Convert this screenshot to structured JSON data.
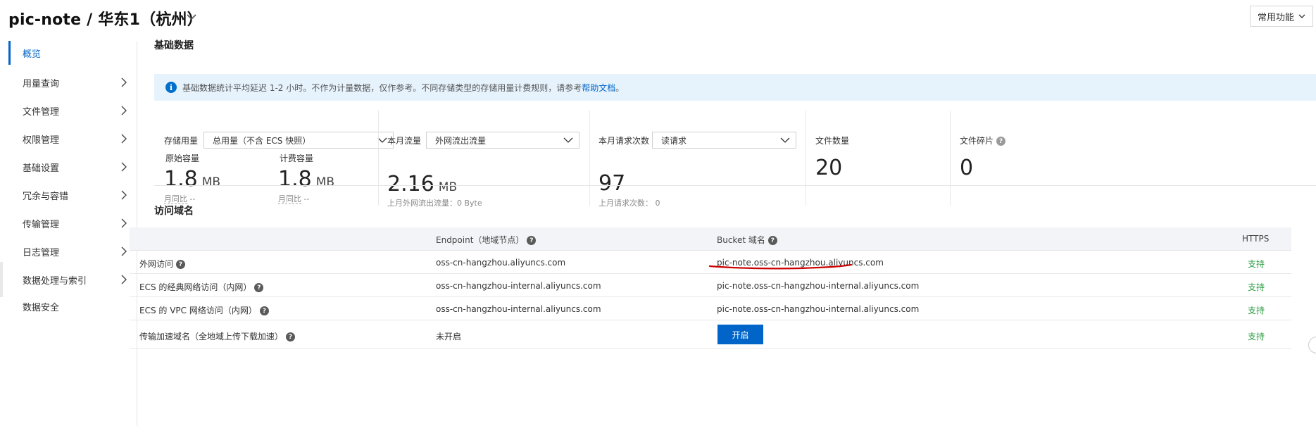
{
  "header": {
    "title": "pic-note / 华东1（杭州）",
    "common_functions": "常用功能"
  },
  "sidebar": {
    "items": [
      {
        "label": "概览"
      },
      {
        "label": "用量查询"
      },
      {
        "label": "文件管理"
      },
      {
        "label": "权限管理"
      },
      {
        "label": "基础设置"
      },
      {
        "label": "冗余与容错"
      },
      {
        "label": "传输管理"
      },
      {
        "label": "日志管理"
      },
      {
        "label": "数据处理与索引"
      },
      {
        "label": "数据安全"
      }
    ]
  },
  "basic_data": {
    "title": "基础数据",
    "info_text": "基础数据统计平均延迟 1-2 小时。不作为计量数据，仅作参考。不同存储类型的存储用量计费规则，请参考",
    "info_link": "帮助文档",
    "info_tail": "。",
    "storage": {
      "label": "存储用量",
      "select": "总用量（不含 ECS 快照）",
      "original_label": "原始容量",
      "original_value": "1.8",
      "original_unit": "MB",
      "original_note_key": "月同比",
      "original_note_val": "--",
      "billing_label": "计费容量",
      "billing_value": "1.8",
      "billing_unit": "MB",
      "billing_note_key": "月同比",
      "billing_note_val": "--"
    },
    "traffic": {
      "label": "本月流量",
      "select": "外网流出流量",
      "value": "2.16",
      "unit": "MB",
      "note": "上月外网流出流量：0 Byte"
    },
    "requests": {
      "label": "本月请求次数",
      "select": "读请求",
      "value": "97",
      "note_key": "上月请求次数：",
      "note_val": "0"
    },
    "files": {
      "label": "文件数量",
      "value": "20"
    },
    "fragments": {
      "label": "文件碎片",
      "value": "0"
    }
  },
  "access_domains": {
    "title": "访问域名",
    "headers": {
      "endpoint": "Endpoint（地域节点）",
      "bucket": "Bucket 域名",
      "https": "HTTPS"
    },
    "rows": [
      {
        "name": "外网访问",
        "endpoint": "oss-cn-hangzhou.aliyuncs.com",
        "bucket": "pic-note.oss-cn-hangzhou.aliyuncs.com",
        "https": "支持"
      },
      {
        "name": "ECS 的经典网络访问（内网）",
        "endpoint": "oss-cn-hangzhou-internal.aliyuncs.com",
        "bucket": "pic-note.oss-cn-hangzhou-internal.aliyuncs.com",
        "https": "支持"
      },
      {
        "name": "ECS 的 VPC 网络访问（内网）",
        "endpoint": "oss-cn-hangzhou-internal.aliyuncs.com",
        "bucket": "pic-note.oss-cn-hangzhou-internal.aliyuncs.com",
        "https": "支持"
      },
      {
        "name": "传输加速域名（全地域上传下载加速）",
        "endpoint": "未开启",
        "bucket_button": "开启",
        "https": "支持"
      }
    ]
  },
  "colors": {
    "accent": "#0064c8",
    "info_bg": "#e6f3fd",
    "support_green": "#2f9e44",
    "annotation_red": "#cc0000"
  }
}
